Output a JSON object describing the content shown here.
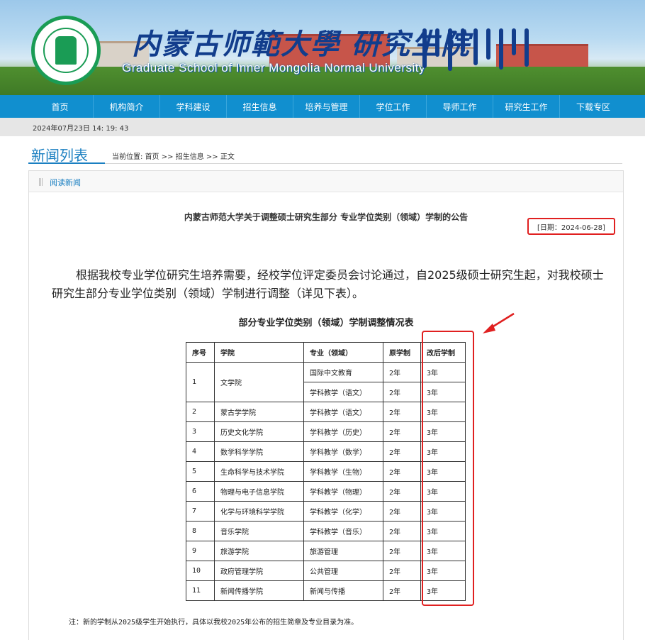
{
  "header": {
    "school_name_cn": "内蒙古师範大學 研究生院",
    "school_name_en": "Graduate School of Inner Mongolia Normal University"
  },
  "nav": {
    "items": [
      "首页",
      "机构简介",
      "学科建设",
      "招生信息",
      "培养与管理",
      "学位工作",
      "导师工作",
      "研究生工作",
      "下载专区"
    ]
  },
  "datetime": "2024年07月23日 14: 19: 43",
  "news": {
    "title": "新闻列表",
    "breadcrumb": {
      "prefix": "当前位置:",
      "items": [
        "首页",
        "招生信息",
        "正文"
      ],
      "sep": ">>"
    }
  },
  "panel": {
    "label": "阅读新闻"
  },
  "article": {
    "title": "内蒙古师范大学关于调整硕士研究生部分 专业学位类别（领域）学制的公告",
    "date": "[日期：2024-06-28]",
    "intro": "根据我校专业学位研究生培养需要，经校学位评定委员会讨论通过，自2025级硕士研究生起，对我校硕士研究生部分专业学位类别（领域）学制进行调整（详见下表）。",
    "table_caption": "部分专业学位类别（领域）学制调整情况表",
    "table": {
      "headers": [
        "序号",
        "学院",
        "专业（领域）",
        "原学制",
        "改后学制"
      ],
      "rows": [
        {
          "no": "1",
          "college": "文学院",
          "major": "国际中文教育",
          "orig": "2年",
          "new": "3年"
        },
        {
          "no": "",
          "college": "",
          "major": "学科教学（语文）",
          "orig": "2年",
          "new": "3年"
        },
        {
          "no": "2",
          "college": "蒙古学学院",
          "major": "学科教学（语文）",
          "orig": "2年",
          "new": "3年"
        },
        {
          "no": "3",
          "college": "历史文化学院",
          "major": "学科教学（历史）",
          "orig": "2年",
          "new": "3年"
        },
        {
          "no": "4",
          "college": "数学科学学院",
          "major": "学科教学（数学）",
          "orig": "2年",
          "new": "3年"
        },
        {
          "no": "5",
          "college": "生命科学与技术学院",
          "major": "学科教学（生物）",
          "orig": "2年",
          "new": "3年"
        },
        {
          "no": "6",
          "college": "物理与电子信息学院",
          "major": "学科教学（物理）",
          "orig": "2年",
          "new": "3年"
        },
        {
          "no": "7",
          "college": "化学与环境科学学院",
          "major": "学科教学（化学）",
          "orig": "2年",
          "new": "3年"
        },
        {
          "no": "8",
          "college": "音乐学院",
          "major": "学科教学（音乐）",
          "orig": "2年",
          "new": "3年"
        },
        {
          "no": "9",
          "college": "旅游学院",
          "major": "旅游管理",
          "orig": "2年",
          "new": "3年"
        },
        {
          "no": "10",
          "college": "政府管理学院",
          "major": "公共管理",
          "orig": "2年",
          "new": "3年"
        },
        {
          "no": "11",
          "college": "新闻传播学院",
          "major": "新闻与传播",
          "orig": "2年",
          "new": "3年"
        }
      ]
    },
    "note": "注：新的学制从2025级学生开始执行，具体以我校2025年公布的招生简章及专业目录为准。"
  },
  "colors": {
    "nav_bg": "#118fcf",
    "accent_blue": "#1a7fc1",
    "highlight_red": "#e02020",
    "logo_green": "#1a9c55"
  }
}
